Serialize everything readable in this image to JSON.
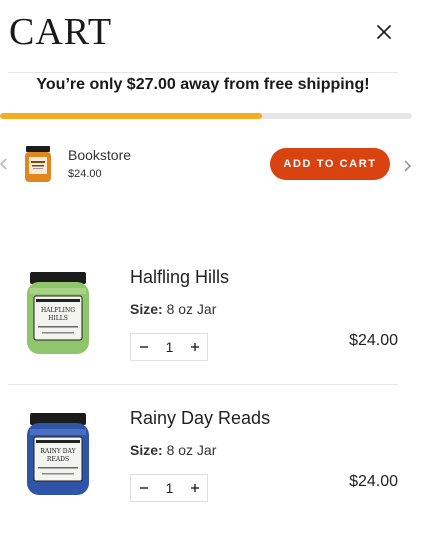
{
  "header": {
    "title": "CART",
    "close_icon": "close-icon"
  },
  "shipping": {
    "message": "You’re only $27.00 away from free shipping!",
    "progress": 0.635,
    "bar_color": "#f7ab1f"
  },
  "upsell": {
    "name": "Bookstore",
    "price": "$24.00",
    "button_label": "ADD TO CART",
    "button_color": "#d9430f",
    "prev_icon": "chevron-left-icon",
    "next_icon": "chevron-right-icon"
  },
  "items": [
    {
      "name": "Halfling Hills",
      "size_label": "Size:",
      "size_value": "8 oz Jar",
      "quantity": "1",
      "price": "$24.00",
      "jar_color": "#8fc56b",
      "label_text": "HALFLING HILLS"
    },
    {
      "name": "Rainy Day Reads",
      "size_label": "Size:",
      "size_value": "8 oz Jar",
      "quantity": "1",
      "price": "$24.00",
      "jar_color": "#2f55a8",
      "label_text": "RAINY DAY READS"
    }
  ]
}
